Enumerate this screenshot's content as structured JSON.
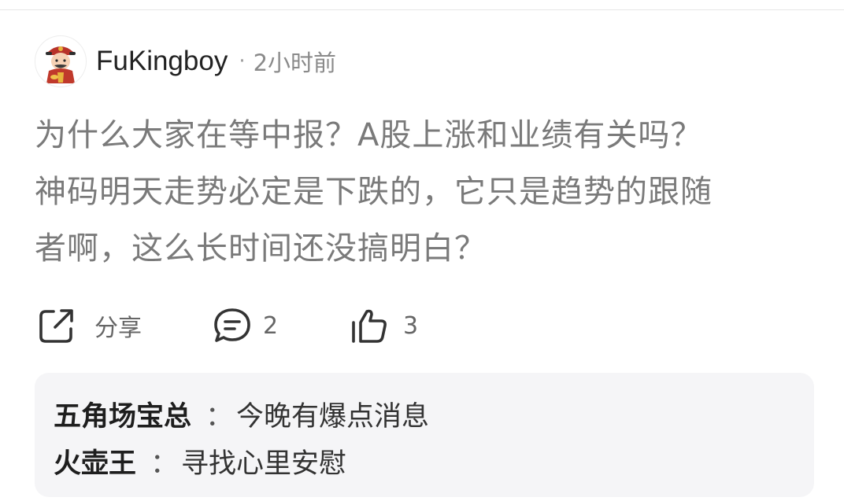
{
  "post": {
    "username": "FuKingboy",
    "separator": "·",
    "time": "2小时前",
    "content_lines": [
      "为什么大家在等中报？A股上涨和业绩有关吗？",
      "神码明天走势必定是下跌的，它只是趋势的跟随",
      "者啊，这么长时间还没搞明白？"
    ]
  },
  "actions": {
    "share_label": "分享",
    "comment_count": "2",
    "like_count": "3"
  },
  "replies": [
    {
      "author": "五角场宝总",
      "separator": "：",
      "text": "今晚有爆点消息"
    },
    {
      "author": "火壶王",
      "separator": "：",
      "text": "寻找心里安慰"
    }
  ],
  "icons": {
    "avatar": "caishen-avatar-icon",
    "share": "share-icon",
    "comment": "comment-icon",
    "like": "thumbs-up-icon"
  }
}
